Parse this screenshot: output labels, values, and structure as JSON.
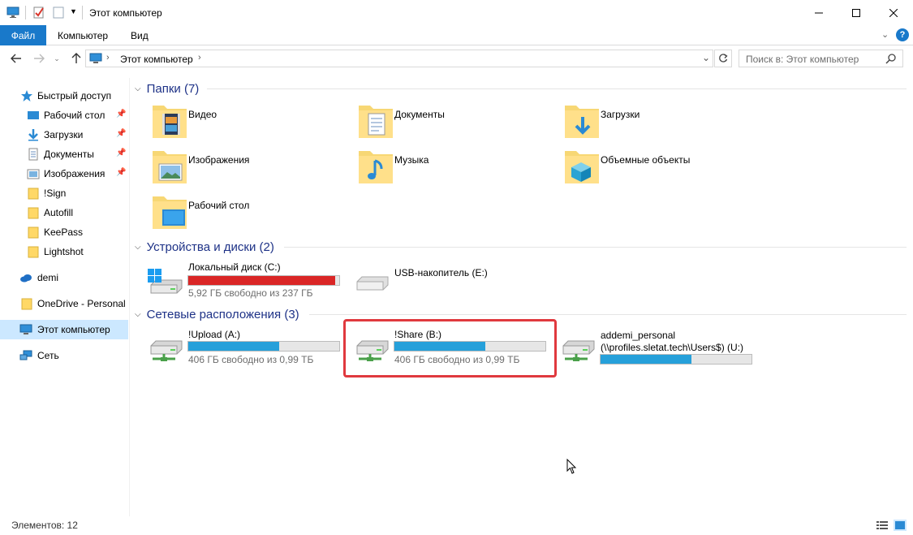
{
  "window": {
    "title": "Этот компьютер"
  },
  "ribbon": {
    "file": "Файл",
    "tabs": [
      "Компьютер",
      "Вид"
    ]
  },
  "address": {
    "path": "Этот компьютер",
    "search_placeholder": "Поиск в: Этот компьютер"
  },
  "sidebar": {
    "quick_access": "Быстрый доступ",
    "pinned": [
      "Рабочий стол",
      "Загрузки",
      "Документы",
      "Изображения"
    ],
    "folders": [
      "!Sign",
      "Autofill",
      "KeePass",
      "Lightshot"
    ],
    "demi": "demi",
    "onedrive": "OneDrive - Personal",
    "this_pc": "Этот компьютер",
    "network": "Сеть"
  },
  "groups": {
    "folders": "Папки (7)",
    "devices": "Устройства и диски (2)",
    "network": "Сетевые расположения (3)"
  },
  "folders": [
    "Видео",
    "Документы",
    "Загрузки",
    "Изображения",
    "Музыка",
    "Объемные объекты",
    "Рабочий стол"
  ],
  "devices": [
    {
      "name": "Локальный диск (C:)",
      "free": "5,92 ГБ свободно из 237 ГБ",
      "used_fraction": 0.975
    },
    {
      "name": "USB-накопитель (E:)"
    }
  ],
  "network_locations": [
    {
      "name": "!Upload (A:)",
      "free": "406 ГБ свободно из 0,99 ТБ",
      "used_fraction": 0.6
    },
    {
      "name": "!Share (B:)",
      "free": "406 ГБ свободно из 0,99 ТБ",
      "used_fraction": 0.6
    },
    {
      "name_line1": "addemi_personal",
      "name_line2": "(\\\\profiles.sletat.tech\\Users$) (U:)",
      "used_fraction": 0.6
    }
  ],
  "status": {
    "count": "Элементов: 12"
  },
  "colors": {
    "accent": "#1979ca",
    "bar_fill": "#26a0da",
    "bar_full": "#da2626",
    "selection": "#cce8ff",
    "highlight": "#e0393e"
  }
}
